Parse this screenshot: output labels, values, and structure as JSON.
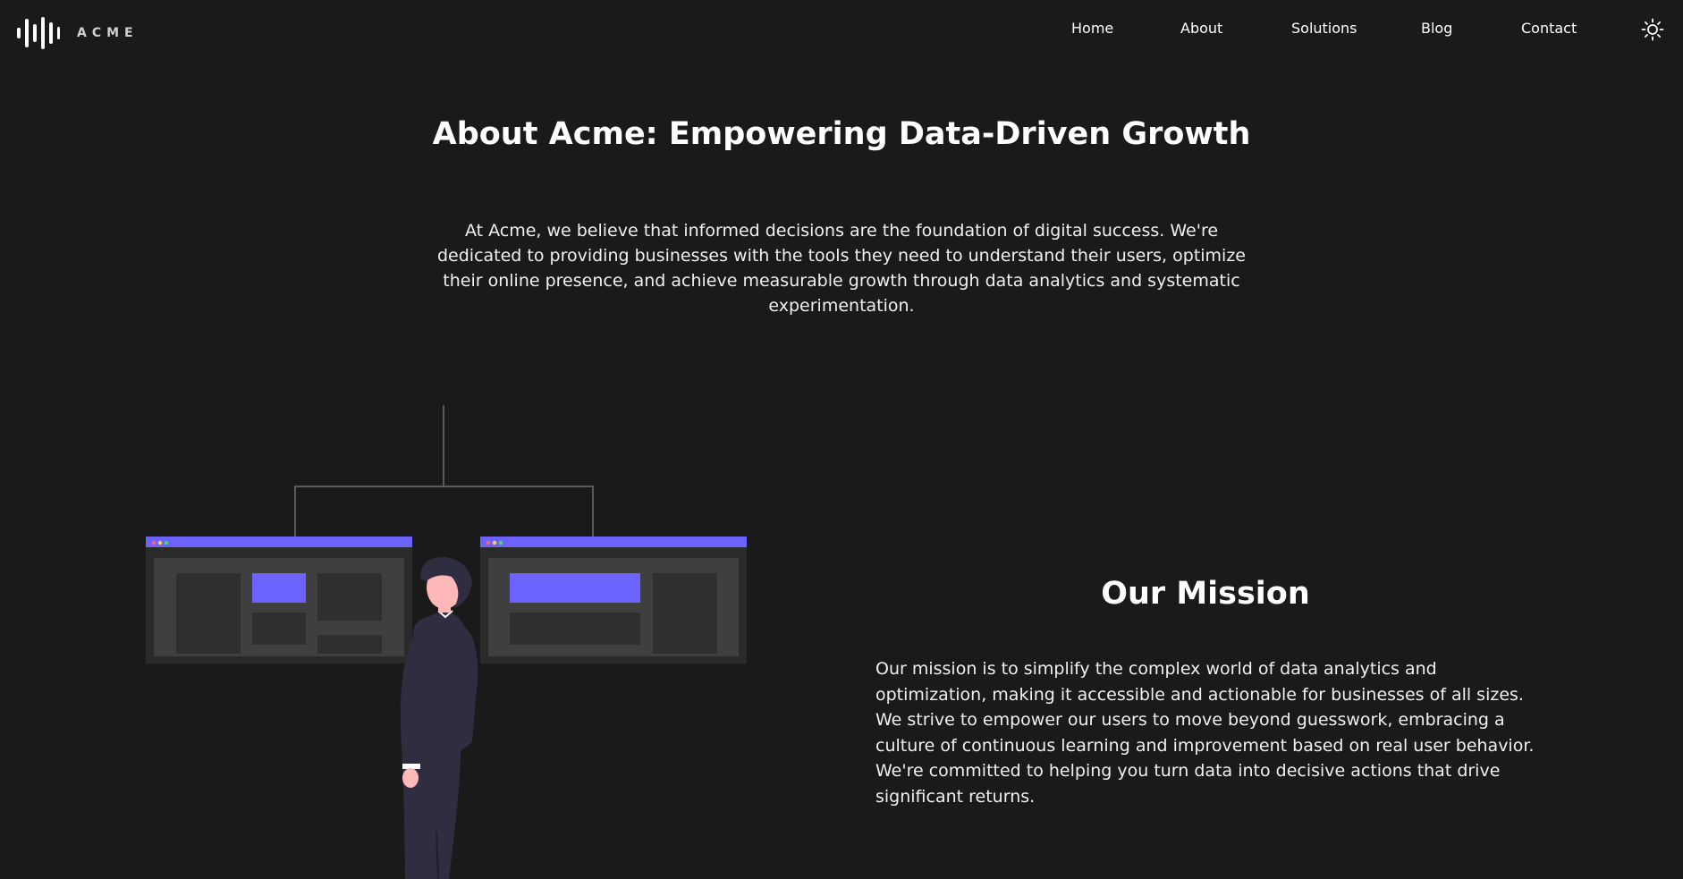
{
  "brand": {
    "name": "ACME"
  },
  "nav": {
    "items": [
      {
        "label": "Home"
      },
      {
        "label": "About"
      },
      {
        "label": "Solutions"
      },
      {
        "label": "Blog"
      },
      {
        "label": "Contact"
      }
    ],
    "theme_toggle_icon": "sun-icon"
  },
  "hero": {
    "title": "About Acme: Empowering Data-Driven Growth",
    "intro": "At Acme, we believe that informed decisions are the foundation of digital success. We're dedicated to providing businesses with the tools they need to understand their users, optimize their online presence, and achieve measurable growth through data analytics and systematic experimentation."
  },
  "mission": {
    "title": "Our Mission",
    "text": "Our mission is to simplify the complex world of data analytics and optimization, making it accessible and actionable for businesses of all sizes. We strive to empower our users to move beyond guesswork, embracing a culture of continuous learning and improvement based on real user behavior. We're committed to helping you turn data into decisive actions that drive significant returns."
  },
  "colors": {
    "background": "#1a1a1a",
    "accent": "#6c63ff",
    "panel": "#3f3f3f",
    "panel_inner": "#2f2f2f"
  }
}
